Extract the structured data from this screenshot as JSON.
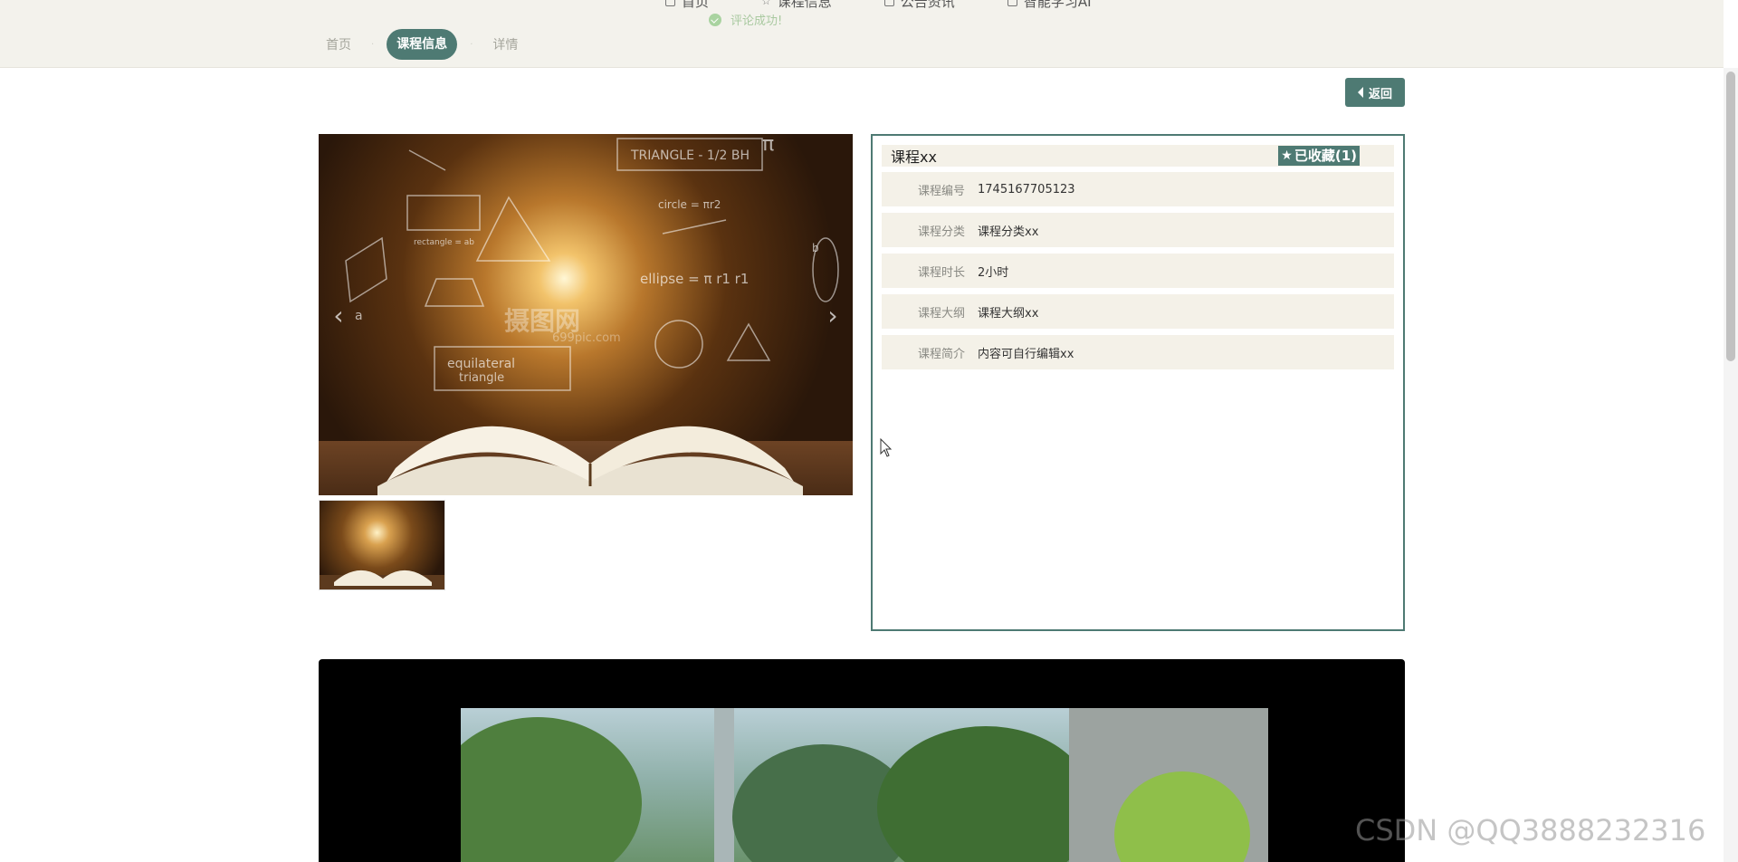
{
  "top_nav": {
    "items": [
      {
        "label": "首页",
        "icon": "square-icon"
      },
      {
        "label": "课程信息",
        "icon": "star-icon"
      },
      {
        "label": "公告资讯",
        "icon": "square-icon"
      },
      {
        "label": "智能学习AI",
        "icon": "square-icon"
      }
    ]
  },
  "toast": {
    "message": "评论成功!"
  },
  "breadcrumb": {
    "home": "首页",
    "current": "课程信息",
    "detail": "详情"
  },
  "back_button": {
    "label": "返回"
  },
  "gallery": {
    "watermark_logo": "摄图网",
    "watermark_url": "699pic.com",
    "prev_arrow": "‹",
    "next_arrow": "›"
  },
  "course": {
    "title": "课程xx",
    "favorite_label": "已收藏(1)",
    "fields": [
      {
        "label": "课程编号",
        "value": "1745167705123"
      },
      {
        "label": "课程分类",
        "value": "课程分类xx"
      },
      {
        "label": "课程时长",
        "value": "2小时"
      },
      {
        "label": "课程大纲",
        "value": "课程大纲xx"
      },
      {
        "label": "课程简介",
        "value": "内容可自行编辑xx"
      }
    ]
  },
  "watermark": {
    "text": "CSDN @QQ3888232316"
  },
  "colors": {
    "accent": "#4e7a73",
    "panel_bg": "#f4f1e8",
    "topbar_bg": "#f3f2ec"
  }
}
